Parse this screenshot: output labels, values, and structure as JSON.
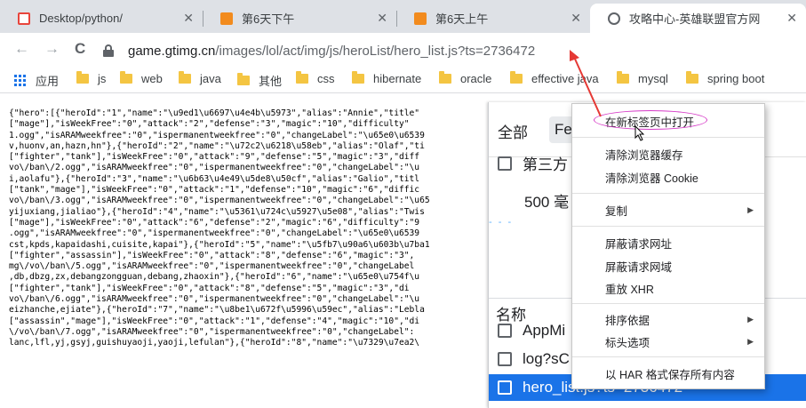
{
  "tabs": [
    {
      "title": "Desktop/python/",
      "fav_color": "#e8453c",
      "close": "✕"
    },
    {
      "title": "第6天下午",
      "fav_color": "#f28b1e",
      "close": "✕"
    },
    {
      "title": "第6天上午",
      "fav_color": "#f28b1e",
      "close": "✕"
    },
    {
      "title": "攻略中心-英雄联盟官方网",
      "fav_color": "#5f6368",
      "close": "✕"
    }
  ],
  "toolbar": {
    "back": "←",
    "forward": "→",
    "reload": "C",
    "url_host": "game.gtimg.cn",
    "url_path": "/images/lol/act/img/js/heroList/hero_list.js?ts=2736472"
  },
  "bookmarks": {
    "apps_label": "应用",
    "folders": [
      "js",
      "web",
      "java",
      "其他",
      "css",
      "hibernate",
      "oracle",
      "effective java",
      "mysql",
      "spring boot"
    ]
  },
  "page_text": [
    "{\"hero\":[{\"heroId\":\"1\",\"name\":\"\\u9ed1\\u6697\\u4e4b\\u5973\",\"alias\":\"Annie\",\"title\"",
    "[\"mage\"],\"isWeekFree\":\"0\",\"attack\":\"2\",\"defense\":\"3\",\"magic\":\"10\",\"difficulty\"",
    "1.ogg\",\"isARAMweekfree\":\"0\",\"ispermanentweekfree\":\"0\",\"changeLabel\":\"\\u65e0\\u6539",
    "v,huonv,an,hazn,hn\"},{\"heroId\":\"2\",\"name\":\"\\u72c2\\u6218\\u58eb\",\"alias\":\"Olaf\",\"ti",
    "[\"fighter\",\"tank\"],\"isWeekFree\":\"0\",\"attack\":\"9\",\"defense\":\"5\",\"magic\":\"3\",\"diff",
    "vo\\/ban\\/2.ogg\",\"isARAMweekfree\":\"0\",\"ispermanentweekfree\":\"0\",\"changeLabel\":\"\\u",
    "i,aolafu\"},{\"heroId\":\"3\",\"name\":\"\\u6b63\\u4e49\\u5de8\\u50cf\",\"alias\":\"Galio\",\"titl",
    "[\"tank\",\"mage\"],\"isWeekFree\":\"0\",\"attack\":\"1\",\"defense\":\"10\",\"magic\":\"6\",\"diffic",
    "vo\\/ban\\/3.ogg\",\"isARAMweekfree\":\"0\",\"ispermanentweekfree\":\"0\",\"changeLabel\":\"\\u65",
    "yijuxiang,jialiao\"},{\"heroId\":\"4\",\"name\":\"\\u5361\\u724c\\u5927\\u5e08\",\"alias\":\"Twis",
    "[\"mage\"],\"isWeekFree\":\"0\",\"attack\":\"6\",\"defense\":\"2\",\"magic\":\"6\",\"difficulty\":\"9",
    ".ogg\",\"isARAMweekfree\":\"0\",\"ispermanentweekfree\":\"0\",\"changeLabel\":\"\\u65e0\\u6539",
    "cst,kpds,kapaidashi,cuisite,kapai\"},{\"heroId\":\"5\",\"name\":\"\\u5fb7\\u90a6\\u603b\\u7ba1",
    "[\"fighter\",\"assassin\"],\"isWeekFree\":\"0\",\"attack\":\"8\",\"defense\":\"6\",\"magic\":\"3\",",
    "mg\\/vo\\/ban\\/5.ogg\",\"isARAMweekfree\":\"0\",\"ispermanentweekfree\":\"0\",\"changeLabel",
    ",db,dbzg,zx,debangzongguan,debang,zhaoxin\"},{\"heroId\":\"6\",\"name\":\"\\u65e0\\u754f\\u",
    "[\"fighter\",\"tank\"],\"isWeekFree\":\"0\",\"attack\":\"8\",\"defense\":\"5\",\"magic\":\"3\",\"di",
    "vo\\/ban\\/6.ogg\",\"isARAMweekfree\":\"0\",\"ispermanentweekfree\":\"0\",\"changeLabel\":\"\\u",
    "eizhanche,ejiate\"},{\"heroId\":\"7\",\"name\":\"\\u8be1\\u672f\\u5996\\u59ec\",\"alias\":\"Lebla",
    "[\"assassin\",\"mage\"],\"isWeekFree\":\"0\",\"attack\":\"1\",\"defense\":\"4\",\"magic\":\"10\",\"di",
    "\\/vo\\/ban\\/7.ogg\",\"isARAMweekfree\":\"0\",\"ispermanentweekfree\":\"0\",\"changeLabel\":",
    "lanc,lfl,yj,gsyj,guishuyaoji,yaoji,lefulan\"},{\"heroId\":\"8\",\"name\":\"\\u7329\\u7ea2\\"
  ],
  "page_text_right": [
    "",
    "es\\/1o",
    " camp",
    "",
    "cn\\/im",
    "\":\"15",
    "",
    "\\/imag",
    ":\"2000",
    "",
    "camp",
    "",
    "oles\":",
    "timg.cn",
    "rPrice",
    "u\\u727",
    "cn\\/im",
    ":\"10",
    "",
    "cs.cn\\/",
    "rice\"",
    "5f17\\"
  ],
  "devtools": {
    "tab_all": "全部",
    "tab_fetch": "Fet",
    "third_party": "第三方",
    "ms_500": "500 毫",
    "dashes": "- - -",
    "name_header": "名称",
    "requests": [
      "AppMi",
      "log?sC",
      "hero_list.js?ts=2736472"
    ]
  },
  "context_menu": {
    "items": [
      {
        "label": "在新标签页中打开",
        "arrow": ""
      },
      {
        "label": "清除浏览器缓存",
        "arrow": ""
      },
      {
        "label": "清除浏览器 Cookie",
        "arrow": ""
      },
      {
        "label": "复制",
        "arrow": "▶"
      },
      {
        "label": "屏蔽请求网址",
        "arrow": ""
      },
      {
        "label": "屏蔽请求网域",
        "arrow": ""
      },
      {
        "label": "重放 XHR",
        "arrow": ""
      },
      {
        "label": "排序依据",
        "arrow": "▶"
      },
      {
        "label": "标头选项",
        "arrow": "▶"
      },
      {
        "label": "以 HAR 格式保存所有内容",
        "arrow": ""
      }
    ]
  },
  "colors": {
    "accent": "#1a73e8",
    "annotation_oval": "#d63bc7",
    "annotation_arrow": "#e53935"
  }
}
